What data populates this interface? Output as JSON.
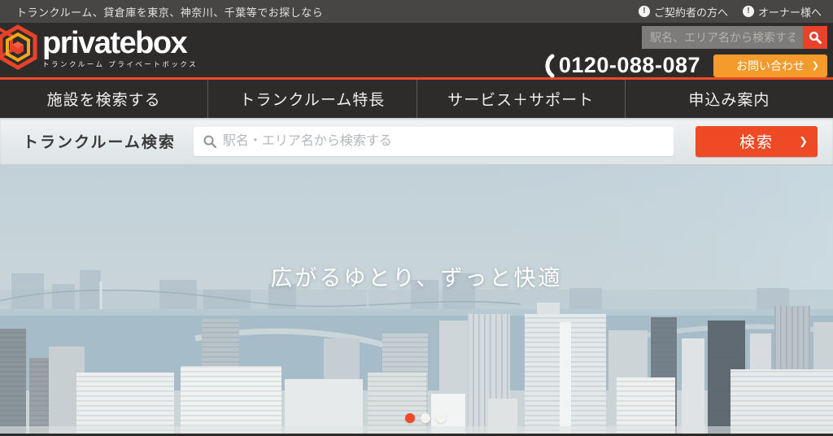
{
  "colors": {
    "accent_red": "#ee4a26",
    "accent_orange": "#f59b2b",
    "header_bg": "#2d2c2a",
    "topbar_bg": "#474645"
  },
  "topbar": {
    "tagline": "トランクルーム、貸倉庫を東京、神奈川、千葉等でお探しなら",
    "info_icon_glyph": "!",
    "links": [
      {
        "label": "ご契約者の方へ"
      },
      {
        "label": "オーナー様へ"
      }
    ]
  },
  "header": {
    "brand": {
      "name": "privatebox",
      "subtitle": "トランクルーム プライベートボックス",
      "logo_icon": "hexagon-cube-logo"
    },
    "mini_search": {
      "placeholder": "駅名、エリア名から検索する"
    },
    "phone": {
      "number": "0120-088-087"
    },
    "contact_button": {
      "label": "お問い合わせ",
      "chevron": "❯"
    }
  },
  "nav": {
    "items": [
      {
        "label": "施設を検索する"
      },
      {
        "label": "トランクルーム特長"
      },
      {
        "label": "サービス＋サポート"
      },
      {
        "label": "申込み案内"
      }
    ]
  },
  "search_section": {
    "label": "トランクルーム検索",
    "placeholder": "駅名・エリア名から検索する",
    "button_label": "検索",
    "button_chevron": "❯"
  },
  "hero": {
    "title": "広がるゆとり、ずっと快適",
    "carousel": {
      "count": 3,
      "active_index": 0
    }
  }
}
